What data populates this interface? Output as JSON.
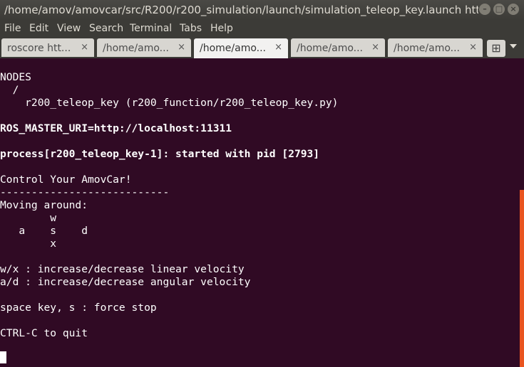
{
  "window": {
    "title": "/home/amov/amovcar/src/R200/r200_simulation/launch/simulation_teleop_key.launch http:...",
    "controls": {
      "minimize": "–",
      "maximize": "□",
      "close": "×"
    }
  },
  "menu": [
    "File",
    "Edit",
    "View",
    "Search",
    "Terminal",
    "Tabs",
    "Help"
  ],
  "tabs": [
    {
      "label": "roscore htt...",
      "close": "×"
    },
    {
      "label": "/home/amo...",
      "close": "×"
    },
    {
      "label": "/home/amo...",
      "close": "×"
    },
    {
      "label": "/home/amo...",
      "close": "×"
    },
    {
      "label": "/home/amo...",
      "close": "×"
    }
  ],
  "new_tab": {
    "glyph": "⊞",
    "icon": "new-tab-icon"
  },
  "terminal": {
    "lines": [
      "NODES",
      "  /",
      "    r200_teleop_key (r200_function/r200_teleop_key.py)",
      "",
      "ROS_MASTER_URI=http://localhost:11311",
      "",
      "process[r200_teleop_key-1]: started with pid [2793]",
      "",
      "Control Your AmovCar!",
      "---------------------------",
      "Moving around:",
      "        w",
      "   a    s    d",
      "        x",
      "",
      "w/x : increase/decrease linear velocity",
      "a/d : increase/decrease angular velocity",
      "",
      "space key, s : force stop",
      "",
      "CTRL-C to quit"
    ]
  },
  "colors": {
    "terminal_bg": "#300a24",
    "accent": "#e95420",
    "chrome": "#3c3b37"
  }
}
